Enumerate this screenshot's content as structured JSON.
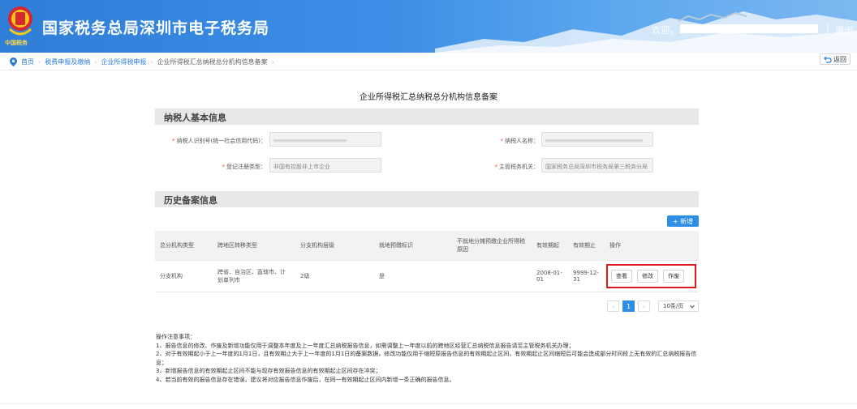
{
  "header": {
    "site_title": "国家税务总局深圳市电子税务局",
    "emblem_text": "中国税务",
    "welcome": "欢迎，",
    "separator": "|",
    "logout": "退出"
  },
  "breadcrumb": {
    "items": [
      "首页",
      "税费申报及缴纳",
      "企业所得税申报",
      "企业所得税汇总纳税总分机构信息备案"
    ],
    "back_label": "返回"
  },
  "page": {
    "title": "企业所得税汇总纳税总分机构信息备案"
  },
  "basic_info": {
    "section_title": "纳税人基本信息",
    "taxpayer_id_label": "纳税人识别号(统一社会信用代码)：",
    "taxpayer_name_label": "纳税人名称：",
    "reg_type_label": "登记注册类型：",
    "reg_type_value": "非国有控股非上市企业",
    "tax_authority_label": "主管税务机关：",
    "tax_authority_value": "国家税务总局深圳市税务局第三税务分局"
  },
  "history": {
    "section_title": "历史备案信息",
    "add_label": "+ 新增",
    "columns": [
      "总分机构类型",
      "跨地区转移类型",
      "分支机构层级",
      "就地预缴标识",
      "不就地分摊预缴企业所得税原因",
      "有效期起",
      "有效期止",
      "操作"
    ],
    "rows": [
      {
        "org_type": "分支机构",
        "transfer_type": "跨省、自治区、直辖市、计划单列市",
        "level": "2级",
        "local_prepay": "是",
        "reason": "",
        "valid_from": "2008-01-01",
        "valid_to": "9999-12-31",
        "actions": [
          "查看",
          "修改",
          "作废"
        ]
      }
    ]
  },
  "pagination": {
    "prev": "‹",
    "current": "1",
    "next": "›",
    "page_size": "10条/页"
  },
  "notes": {
    "title": "操作注意事项：",
    "items": [
      "1、报告信息的修改、作废及新增功能仅用于调整本年度及上一年度汇总纳税报告信息，如需调整上一年度以前的跨地区经营汇总纳税信息报告请至主管税务机关办理；",
      "2、对于有效期起小于上一年度的1月1日，且有效期止大于上一年度的1月1日的备案数据，修改功能仅用于缩短原报告信息的有效期起止区间，有效期起止区间缩短后可能会造成部分时间段上无有效的汇总纳税报告信息；",
      "3、新增报告信息的有效期起止区间不能与现存有效报告信息的有效期起止区间存在冲突；",
      "4、若当前有效的报告信息存在错误，建议将对应报告信息作废后，在同一有效期起止区间内新增一条正确的报告信息。"
    ]
  },
  "colors": {
    "header_blue": "#2f7ed8",
    "link_blue": "#2b7bd6",
    "primary": "#2e8de4",
    "highlight_red": "#e0191e",
    "required": "#e8502f"
  },
  "icons": [
    "tax-emblem-icon",
    "location-pin-icon",
    "back-arrow-icon",
    "chevron-down-icon"
  ]
}
